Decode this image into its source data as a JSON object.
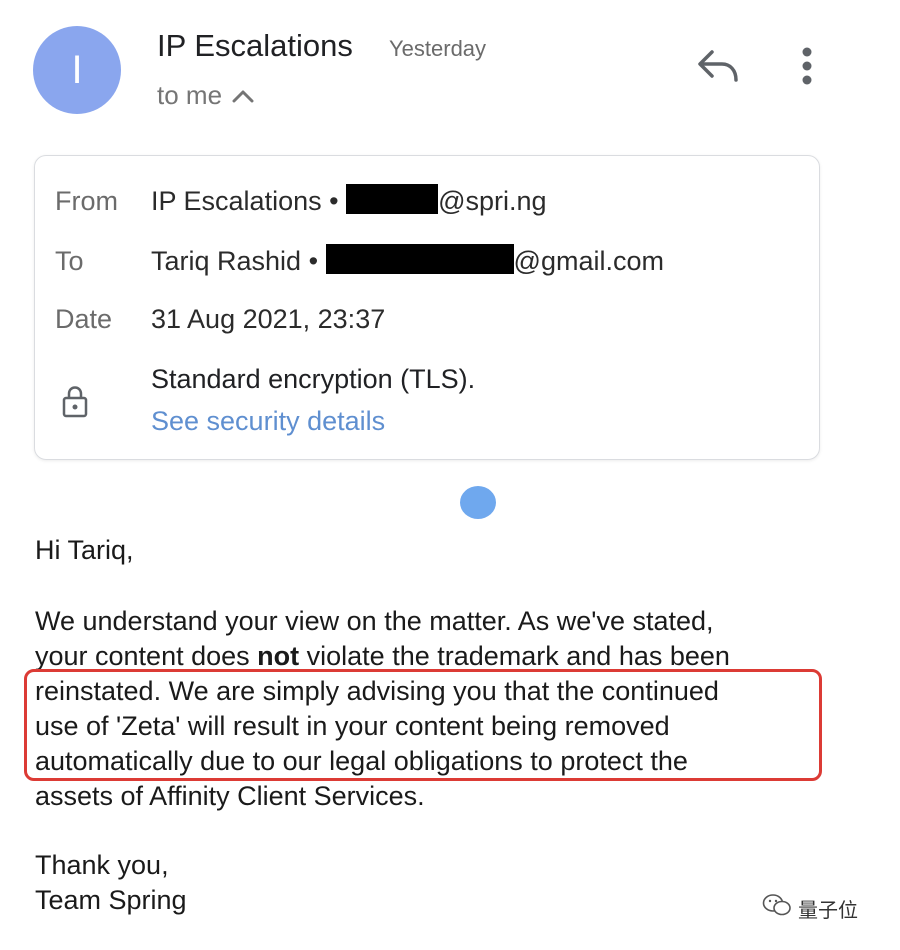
{
  "header": {
    "avatar_letter": "I",
    "sender_name": "IP Escalations",
    "time": "Yesterday",
    "to_me": "to me"
  },
  "details": {
    "from_label": "From",
    "from_name": "IP Escalations",
    "from_domain": "@spri.ng",
    "to_label": "To",
    "to_name": "Tariq Rashid",
    "to_domain": "@gmail.com",
    "date_label": "Date",
    "date_value": "31 Aug 2021, 23:37",
    "encryption": "Standard encryption (TLS).",
    "security_link": "See security details"
  },
  "message": {
    "greeting": "Hi Tariq,",
    "line1": "We understand your view on the matter. As we've stated,",
    "line2_pre": "your content does ",
    "line2_bold": "not",
    "line2_post": " violate the trademark and has been",
    "line3": "reinstated. We are simply advising you that the continued",
    "line4": "use of 'Zeta' will result in your content being removed",
    "line5": "automatically due to our legal obligations to protect the",
    "line6": "assets of Affinity Client Services.",
    "closing1": "Thank you,",
    "closing2": "Team Spring"
  },
  "watermark": "量子位",
  "colors": {
    "avatar": "#8aa6ee",
    "link": "#5f8fd0",
    "highlight_border": "#dc3b35",
    "dot": "#6fa8ee"
  },
  "icons": [
    "reply-icon",
    "more-vert-icon",
    "chevron-up-icon",
    "lock-icon",
    "wechat-icon"
  ]
}
